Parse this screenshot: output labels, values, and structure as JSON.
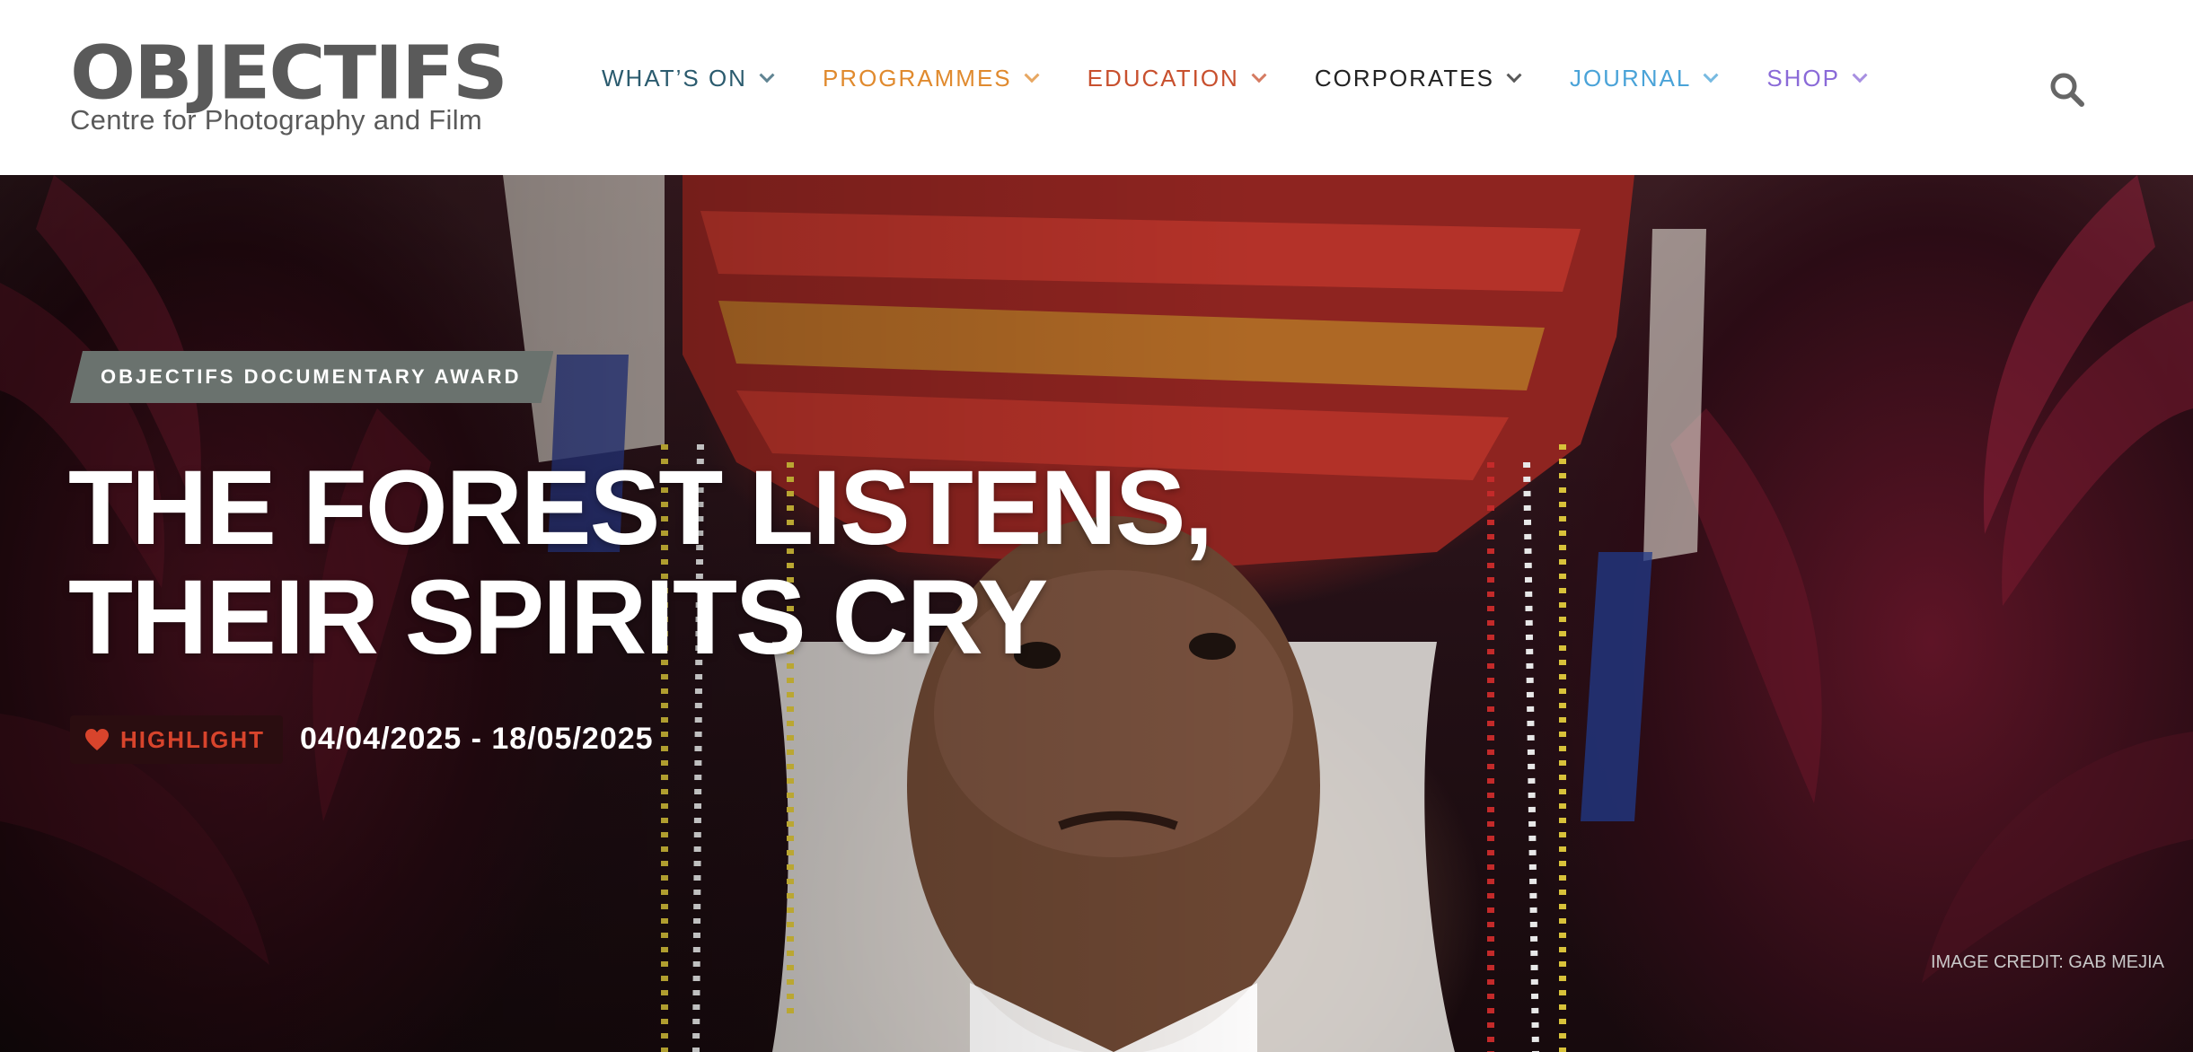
{
  "logo": {
    "wordmark": "OBJECTIFS",
    "tagline": "Centre for Photography and Film"
  },
  "nav": {
    "items": [
      {
        "label": "WHAT’S ON",
        "color": "#2b5b6e"
      },
      {
        "label": "PROGRAMMES",
        "color": "#e08a2e"
      },
      {
        "label": "EDUCATION",
        "color": "#c8502e"
      },
      {
        "label": "CORPORATES",
        "color": "#222222"
      },
      {
        "label": "JOURNAL",
        "color": "#4aa3d8"
      },
      {
        "label": "SHOP",
        "color": "#8a6ad8"
      }
    ],
    "search_icon": "search-icon"
  },
  "hero": {
    "category": "OBJECTIFS DOCUMENTARY AWARD",
    "title_line1": "THE FOREST LISTENS,",
    "title_line2": "THEIR SPIRITS CRY",
    "highlight_label": "HIGHLIGHT",
    "highlight_icon": "heart-icon",
    "dates": "04/04/2025 - 18/05/2025",
    "credit": "IMAGE CREDIT: GAB MEJIA"
  },
  "colors": {
    "highlight_text": "#d8442c",
    "badge_bg": "#6a726e",
    "logo_gray": "#5a5a5a"
  }
}
